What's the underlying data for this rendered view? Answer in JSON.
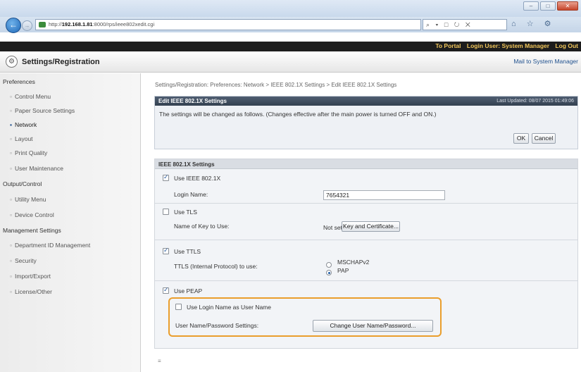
{
  "browser": {
    "url_prefix": "http://",
    "url_host": "192.168.1.81",
    "url_rest": ":8000/rps/ieee802xedit.cgi",
    "search_glyphs": "⌕ ▾ □ ↻ ✕",
    "toolbar_glyphs": "⌂ ☆ ⚙"
  },
  "topbar": {
    "portal": "To Portal",
    "login_user": "Login User: System Manager",
    "logout": "Log Out"
  },
  "header": {
    "title": "Settings/Registration",
    "mail": "Mail to System Manager"
  },
  "sidebar": {
    "groups": {
      "preferences": "Preferences",
      "output": "Output/Control",
      "management": "Management Settings"
    },
    "items": {
      "control_menu": "Control Menu",
      "paper_source": "Paper Source Settings",
      "network": "Network",
      "layout": "Layout",
      "print_quality": "Print Quality",
      "user_maintenance": "User Maintenance",
      "utility_menu": "Utility Menu",
      "device_control": "Device Control",
      "dept_id": "Department ID Management",
      "security": "Security",
      "import_export": "Import/Export",
      "license": "License/Other"
    }
  },
  "main": {
    "breadcrumb": "Settings/Registration: Preferences: Network > IEEE 802.1X Settings > Edit IEEE 802.1X Settings",
    "edit_title": "Edit IEEE 802.1X Settings",
    "last_updated": "Last Updated: 08/07 2015 01:49:06",
    "message": "The settings will be changed as follows. (Changes effective after the main power is turned OFF and ON.)",
    "ok": "OK",
    "cancel": "Cancel",
    "section_title": "IEEE 802.1X Settings",
    "use_ieee": "Use IEEE 802.1X",
    "login_name_label": "Login Name:",
    "login_name_value": "7654321",
    "use_tls": "Use TLS",
    "key_label": "Name of Key to Use:",
    "key_value": "Not set",
    "key_button": "Key and Certificate...",
    "use_ttls": "Use TTLS",
    "ttls_label": "TTLS (Internal Protocol) to use:",
    "opt_mschap": "MSCHAPv2",
    "opt_pap": "PAP",
    "use_peap": "Use PEAP",
    "use_login_as_user": "Use Login Name as User Name",
    "user_pw_label": "User Name/Password Settings:",
    "change_button": "Change User Name/Password...",
    "footer_mark": "≡"
  },
  "state": {
    "use_ieee": true,
    "use_tls": false,
    "use_ttls": true,
    "use_peap": true,
    "use_login_as_user": false,
    "ttls_protocol": "PAP"
  },
  "colors": {
    "highlight": "#ea9e2c",
    "header_bar": "#1d1d1d",
    "accent_text": "#f1c65b"
  }
}
